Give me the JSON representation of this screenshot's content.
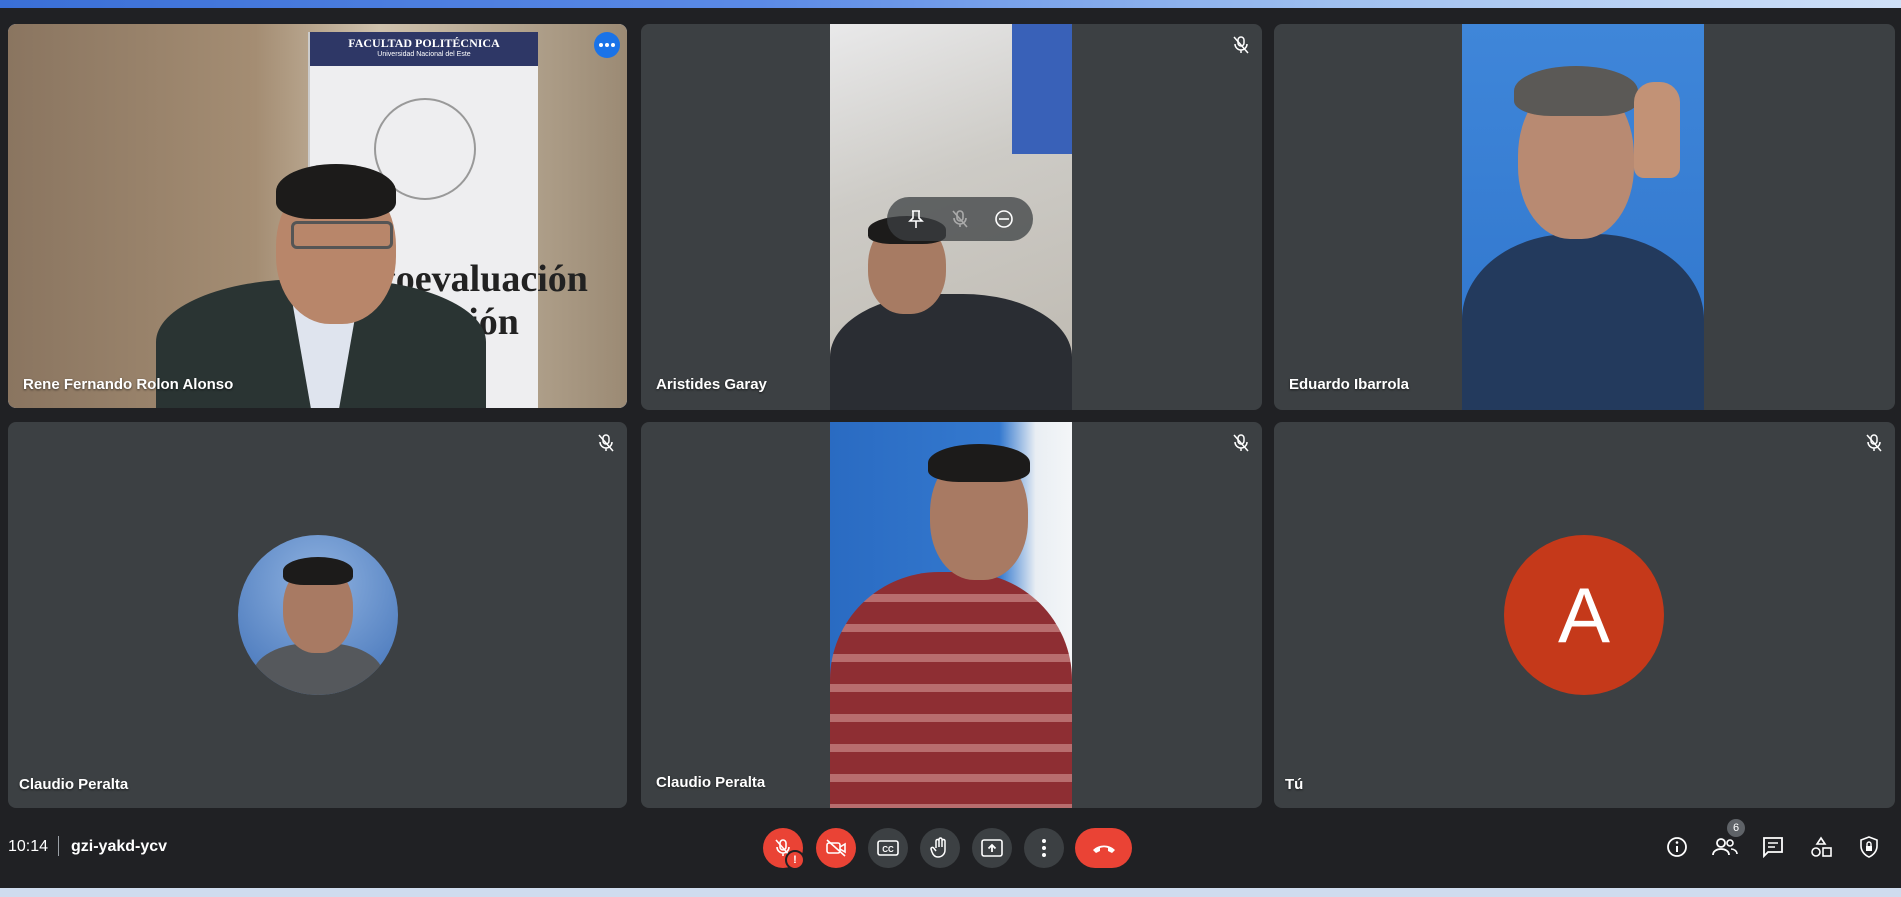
{
  "meeting": {
    "time": "10:14",
    "code": "gzi-yakd-ycv",
    "participant_count": "6"
  },
  "tiles": [
    {
      "name": "Rene Fernando Rolon Alonso",
      "state": "speaking-pinned"
    },
    {
      "name": "Aristides Garay",
      "muted": true
    },
    {
      "name": "Eduardo Ibarrola",
      "muted": false
    },
    {
      "name": "Claudio Peralta",
      "muted": true,
      "camera": "off"
    },
    {
      "name": "Claudio Peralta",
      "muted": true
    },
    {
      "name": "Tú",
      "muted": true,
      "avatar_letter": "A"
    }
  ],
  "background_text": {
    "banner_line1": "FACULTAD POLITÉCNICA",
    "banner_line2": "Universidad Nacional del Este",
    "banner_word1": "utoevaluación",
    "banner_word2": "ditación"
  },
  "controls": {
    "mic_icon": "mic-off-icon",
    "camera_icon": "camera-off-icon",
    "captions_icon": "captions-icon",
    "hand_icon": "raise-hand-icon",
    "present_icon": "present-screen-icon",
    "more_icon": "more-vert-icon",
    "end_icon": "end-call-icon",
    "warning_mark": "!"
  },
  "side_controls": [
    "info-icon",
    "people-icon",
    "chat-icon",
    "activities-icon",
    "host-controls-icon"
  ],
  "colors": {
    "background": "#202124",
    "tile": "#3c4043",
    "active_outline": "#8ab4f8",
    "danger": "#ea4335",
    "avatar_a": "#c5391a",
    "accent": "#1a73e8"
  }
}
